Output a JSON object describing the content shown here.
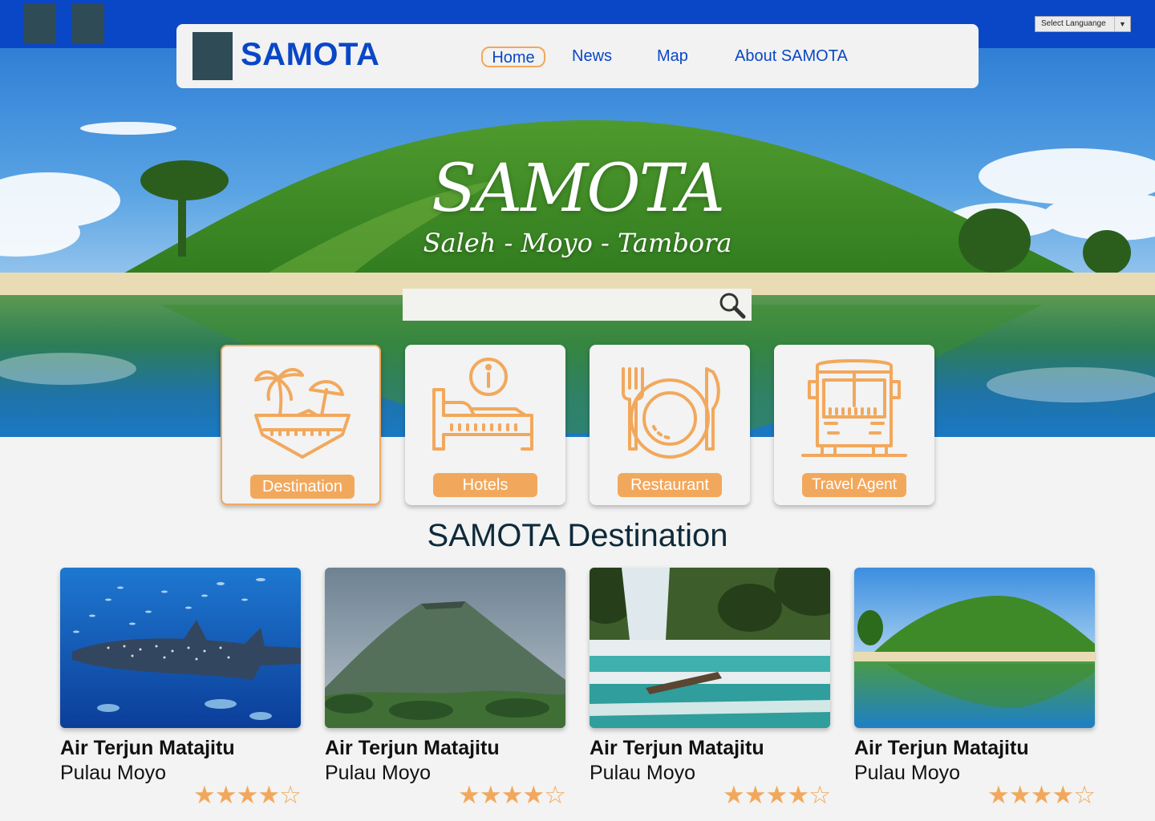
{
  "language_select": {
    "label": "Select Languange"
  },
  "nav": {
    "brand": "SAMOTA",
    "links": {
      "home": "Home",
      "news": "News",
      "map": "Map",
      "about": "About SAMOTA"
    }
  },
  "hero": {
    "title": "SAMOTA",
    "subtitle": "Saleh - Moyo - Tambora"
  },
  "search": {
    "value": "",
    "placeholder": ""
  },
  "categories": [
    {
      "label": "Destination",
      "icon": "island-icon",
      "active": true
    },
    {
      "label": "Hotels",
      "icon": "hotel-bed-icon",
      "active": false
    },
    {
      "label": "Restaurant",
      "icon": "plate-cutlery-icon",
      "active": false
    },
    {
      "label": "Travel Agent",
      "icon": "bus-icon",
      "active": false
    }
  ],
  "section_title": "SAMOTA Destination",
  "destinations": [
    {
      "name": "Air Terjun Matajitu",
      "location": "Pulau Moyo",
      "rating": 4,
      "rating_display": "★★★★☆"
    },
    {
      "name": "Air Terjun Matajitu",
      "location": "Pulau Moyo",
      "rating": 4,
      "rating_display": "★★★★☆"
    },
    {
      "name": "Air Terjun Matajitu",
      "location": "Pulau Moyo",
      "rating": 4,
      "rating_display": "★★★★☆"
    },
    {
      "name": "Air Terjun Matajitu",
      "location": "Pulau Moyo",
      "rating": 4,
      "rating_display": "★★★★☆"
    }
  ],
  "colors": {
    "primary_blue": "#0a47c7",
    "accent_orange": "#f2a85c",
    "dark_slate": "#2f4b55",
    "background": "#f2f3f2"
  }
}
